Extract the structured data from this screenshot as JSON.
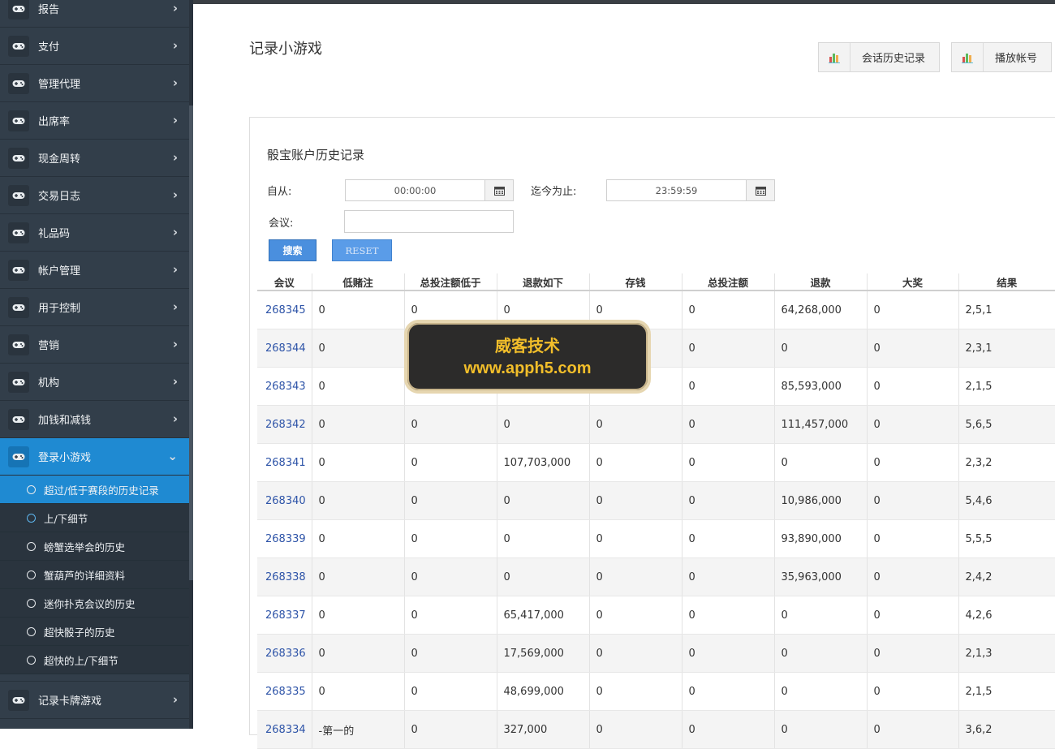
{
  "sidebar": {
    "menu": [
      {
        "label": "报告",
        "icon": "gamepad-icon"
      },
      {
        "label": "支付",
        "icon": "gamepad-icon"
      },
      {
        "label": "管理代理",
        "icon": "gamepad-icon"
      },
      {
        "label": "出席率",
        "icon": "gamepad-icon"
      },
      {
        "label": "现金周转",
        "icon": "gamepad-icon"
      },
      {
        "label": "交易日志",
        "icon": "gamepad-icon"
      },
      {
        "label": "礼品码",
        "icon": "gamepad-icon"
      },
      {
        "label": "帐户管理",
        "icon": "gamepad-icon"
      },
      {
        "label": "用于控制",
        "icon": "gamepad-icon"
      },
      {
        "label": "营销",
        "icon": "gamepad-icon"
      },
      {
        "label": "机构",
        "icon": "gamepad-icon"
      },
      {
        "label": "加钱和减钱",
        "icon": "gamepad-icon"
      }
    ],
    "active_menu": {
      "label": "登录小游戏",
      "icon": "gamepad-icon"
    },
    "sub_items": [
      {
        "label": "超过/低于赛段的历史记录"
      },
      {
        "label": "上/下细节"
      },
      {
        "label": "螃蟹选举会的历史"
      },
      {
        "label": "蟹葫芦的详细资料"
      },
      {
        "label": "迷你扑克会议的历史"
      },
      {
        "label": "超快骰子的历史"
      },
      {
        "label": "超快的上/下细节"
      }
    ],
    "after_menu": {
      "label": "记录卡牌游戏",
      "icon": "gamepad-icon"
    }
  },
  "header": {
    "title": "记录小游戏",
    "buttons": [
      {
        "label": "会话历史记录",
        "icon": "bar-chart-icon"
      },
      {
        "label": "播放帐号",
        "icon": "bar-chart-icon"
      }
    ]
  },
  "panel": {
    "title": "骰宝账户历史记录",
    "from_label": "自从:",
    "from_value": "00:00:00",
    "to_label": "迄今为止:",
    "to_value": "23:59:59",
    "session_label": "会议:",
    "session_value": "",
    "search_label": "搜索",
    "reset_label": "RESET"
  },
  "table": {
    "headers": [
      "会议",
      "低赌注",
      "总投注额低于",
      "退款如下",
      "存钱",
      "总投注额",
      "退款",
      "大奖",
      "结果"
    ],
    "rows": [
      [
        "268345",
        "0",
        "0",
        "0",
        "0",
        "0",
        "64,268,000",
        "0",
        "2,5,1"
      ],
      [
        "268344",
        "0",
        "",
        "",
        "",
        "0",
        "0",
        "0",
        "2,3,1"
      ],
      [
        "268343",
        "0",
        "",
        "",
        "",
        "0",
        "85,593,000",
        "0",
        "2,1,5"
      ],
      [
        "268342",
        "0",
        "0",
        "0",
        "0",
        "0",
        "111,457,000",
        "0",
        "5,6,5"
      ],
      [
        "268341",
        "0",
        "0",
        "107,703,000",
        "0",
        "0",
        "0",
        "0",
        "2,3,2"
      ],
      [
        "268340",
        "0",
        "0",
        "0",
        "0",
        "0",
        "10,986,000",
        "0",
        "5,4,6"
      ],
      [
        "268339",
        "0",
        "0",
        "0",
        "0",
        "0",
        "93,890,000",
        "0",
        "5,5,5"
      ],
      [
        "268338",
        "0",
        "0",
        "0",
        "0",
        "0",
        "35,963,000",
        "0",
        "2,4,2"
      ],
      [
        "268337",
        "0",
        "0",
        "65,417,000",
        "0",
        "0",
        "0",
        "0",
        "4,2,6"
      ],
      [
        "268336",
        "0",
        "0",
        "17,569,000",
        "0",
        "0",
        "0",
        "0",
        "2,1,3"
      ],
      [
        "268335",
        "0",
        "0",
        "48,699,000",
        "0",
        "0",
        "0",
        "0",
        "2,1,5"
      ],
      [
        "268334",
        "-第一的",
        "0",
        "327,000",
        "0",
        "0",
        "0",
        "0",
        "3,6,2"
      ]
    ]
  },
  "watermark": {
    "line1": "威客技术",
    "line2": "www.apph5.com"
  },
  "colors": {
    "sidebar_bg": "#323e4a",
    "active_blue": "#1f8ad2",
    "button_blue": "#4a8fde",
    "link_blue": "#2e54a8",
    "watermark_gold": "#f2be2a"
  }
}
